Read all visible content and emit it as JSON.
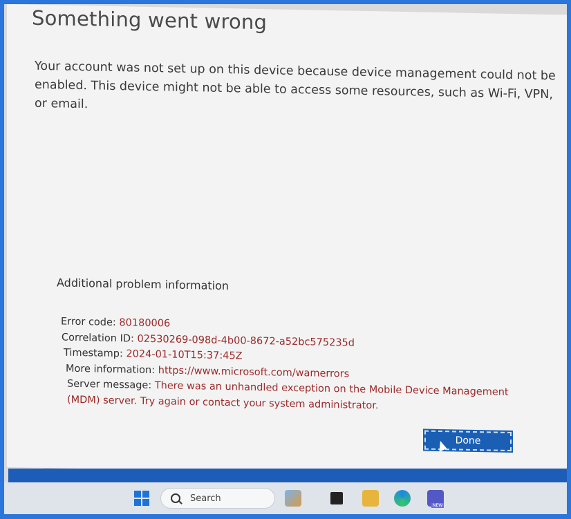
{
  "dialog": {
    "title": "Something went wrong",
    "message": "Your account was not set up on this device because device management could not be enabled. This device might not be able to access some resources, such as Wi-Fi, VPN, or email.",
    "section_heading": "Additional problem information",
    "info": {
      "error_code_label": "Error code:",
      "error_code_value": "80180006",
      "correlation_label": "Correlation ID:",
      "correlation_value": "02530269-098d-4b00-8672-a52bc575235d",
      "timestamp_label": "Timestamp:",
      "timestamp_value": "2024-01-10T15:37:45Z",
      "more_info_label": "More information:",
      "more_info_link": "https://www.microsoft.com/wamerrors",
      "server_msg_label": "Server message:",
      "server_msg_line1": "There was an unhandled exception on the Mobile Device Management",
      "server_msg_line2": "(MDM) server. Try again or contact your system administrator."
    },
    "done_label": "Done"
  },
  "taskbar": {
    "search_placeholder": "Search",
    "icons": [
      "start-icon",
      "search-icon",
      "widgets-icon",
      "task-view-icon",
      "file-explorer-icon",
      "edge-icon",
      "teams-icon"
    ],
    "teams_badge": "NEW"
  },
  "colors": {
    "accent": "#1a5fb4",
    "error_value": "#9b2a2a"
  }
}
